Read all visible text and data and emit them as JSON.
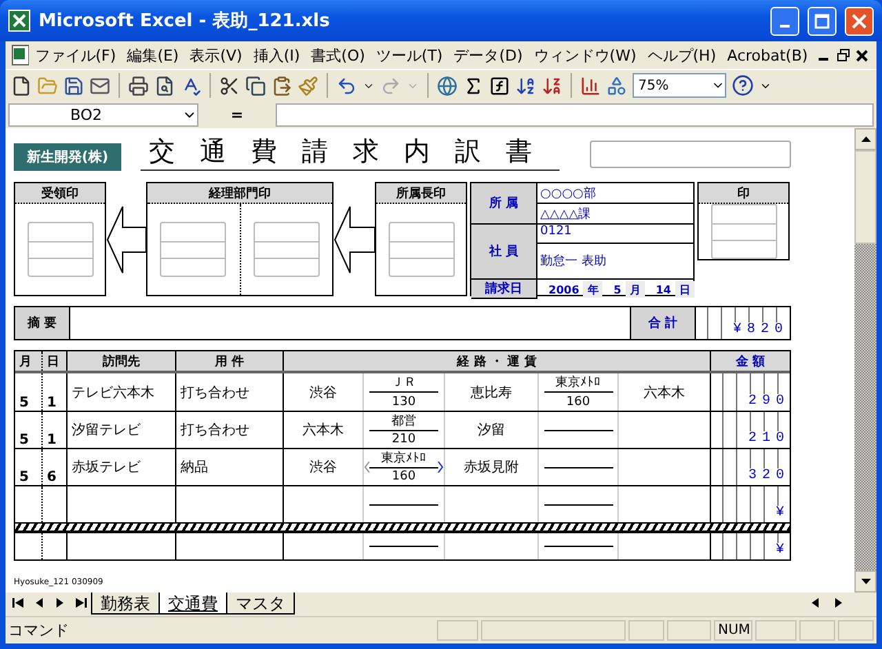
{
  "window": {
    "title": "Microsoft Excel - 表助_121.xls"
  },
  "menu": [
    "ファイル(F)",
    "編集(E)",
    "表示(V)",
    "挿入(I)",
    "書式(O)",
    "ツール(T)",
    "データ(D)",
    "ウィンドウ(W)",
    "ヘルプ(H)",
    "Acrobat(B)"
  ],
  "toolbar": {
    "zoom": "75%"
  },
  "formula_bar": {
    "name_box": "BO2",
    "equals": "="
  },
  "form": {
    "company": "新生開発(株)",
    "title": "交通費請求内訳書",
    "stamps": [
      {
        "label": "受領印",
        "kind": "single"
      },
      {
        "label": "経理部門印",
        "kind": "double"
      },
      {
        "label": "所属長印",
        "kind": "single"
      }
    ],
    "info": {
      "affiliation_label": "所 属",
      "department": "○○○○部",
      "section": "△△△△課",
      "employee_label": "社 員",
      "employee_id": "0121",
      "employee_name": "勤怠一 表助",
      "date_label": "請求日",
      "year": "2006",
      "year_unit": "年",
      "month": "5",
      "month_unit": "月",
      "day": "14",
      "day_unit": "日"
    },
    "seal": {
      "label": "印"
    },
    "summary": {
      "label": "摘 要",
      "total_label": "合 計",
      "total": "¥820"
    },
    "table": {
      "columns": [
        "月",
        "日",
        "訪問先",
        "用 件",
        "経 路 ・ 運 賃",
        "金 額"
      ],
      "rows": [
        {
          "month": "5",
          "day": "1",
          "destination": "テレビ六本木",
          "purpose": "打ち合わせ",
          "from": "渋谷",
          "leg1": {
            "line": "ＪＲ",
            "fare": "130"
          },
          "via": "恵比寿",
          "leg2": {
            "line": "東京ﾒﾄﾛ",
            "fare": "160"
          },
          "to": "六本木",
          "amount": "290"
        },
        {
          "month": "5",
          "day": "1",
          "destination": "汐留テレビ",
          "purpose": "打ち合わせ",
          "from": "六本木",
          "leg1": {
            "line": "都営",
            "fare": "210"
          },
          "via": "汐留",
          "amount": "210"
        },
        {
          "month": "5",
          "day": "6",
          "destination": "赤坂テレビ",
          "purpose": "納品",
          "from": "渋谷",
          "leg1": {
            "line": "東京ﾒﾄﾛ",
            "fare": "160",
            "arrows": true
          },
          "via": "赤坂見附",
          "amount": "320"
        },
        {
          "amount": "¥"
        },
        {
          "amount": "¥",
          "page_break_before": true
        }
      ]
    },
    "footer_note": "Hyosuke_121  030909"
  },
  "sheet_tabs": [
    {
      "label": "勤務表",
      "selected": false
    },
    {
      "label": "交通費",
      "selected": true
    },
    {
      "label": "マスタ",
      "selected": false
    }
  ],
  "status_bar": {
    "mode": "コマンド",
    "indicator": "NUM"
  }
}
